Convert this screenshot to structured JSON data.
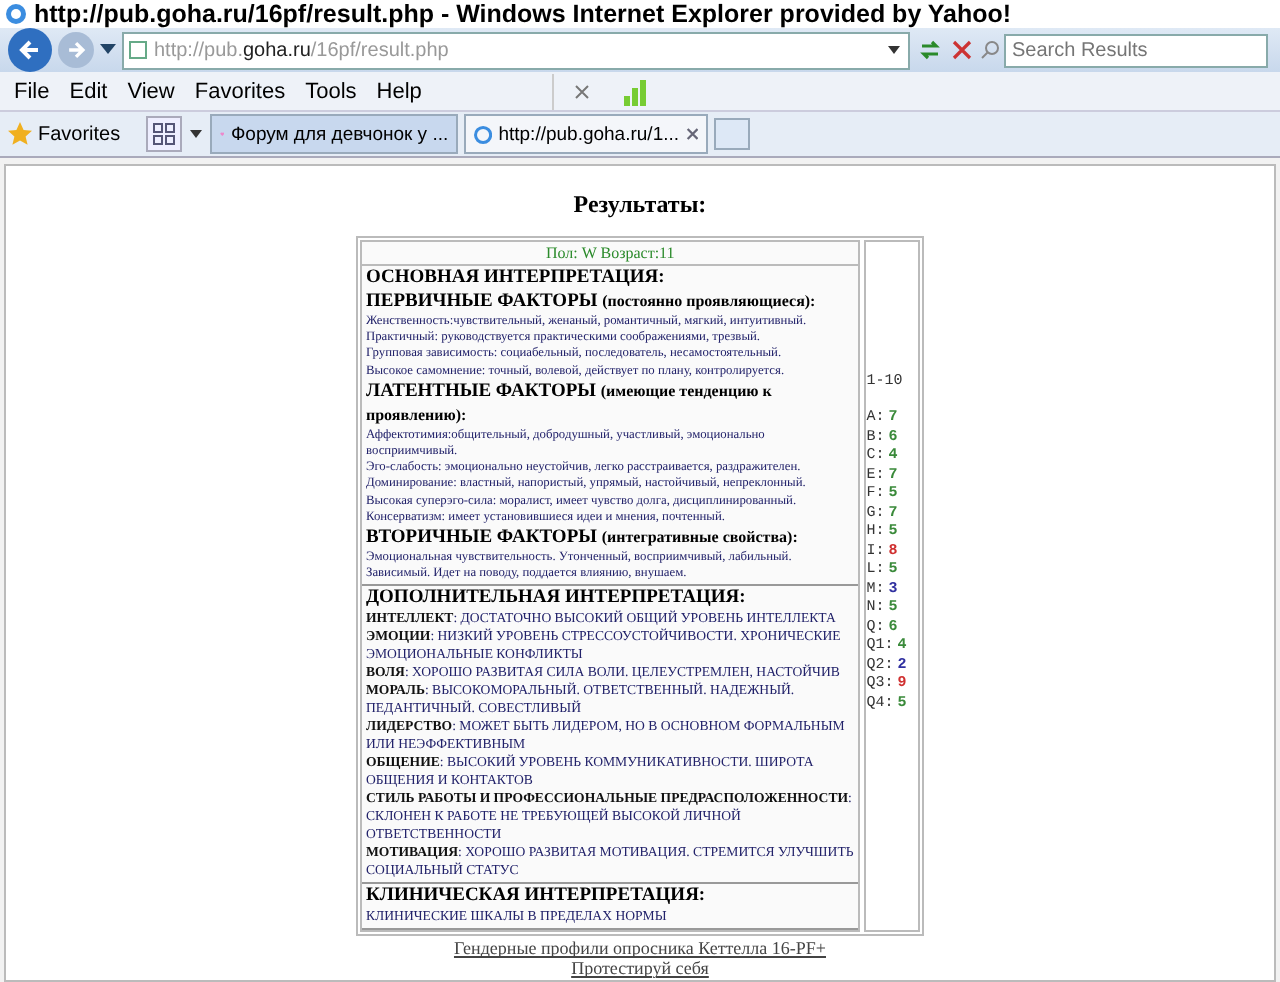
{
  "window": {
    "title": "http://pub.goha.ru/16pf/result.php - Windows Internet Explorer provided by Yahoo!"
  },
  "address_bar": {
    "url_prefix": "http://pub.",
    "url_host": "goha.ru",
    "url_path": "/16pf/result.php",
    "search_placeholder": "Search Results"
  },
  "menu": [
    "File",
    "Edit",
    "View",
    "Favorites",
    "Tools",
    "Help"
  ],
  "favorites_bar": {
    "label": "Favorites",
    "tabs": [
      {
        "title": "Форум для девчонок у ...",
        "selected": false
      },
      {
        "title": "http://pub.goha.ru/1...",
        "selected": true
      }
    ]
  },
  "page": {
    "heading": "Результаты:",
    "info": "Пол: W   Возраст:11",
    "sections": [
      {
        "kind": "main",
        "title": "ОСНОВНАЯ ИНТЕРПРЕТАЦИЯ:",
        "groups": [
          {
            "title": "ПЕРВИЧНЫЕ ФАКТОРЫ",
            "note": "(постоянно проявляющиеся):",
            "lines": [
              "Женственность:чувствительный, женаный, романтичный, мягкий, интуитивный.",
              "Практичный: руководствуется практическими соображениями, трезвый.",
              "Групповая зависимость: социабельный, последователь, несамостоятельный.",
              "Высокое самомнение: точный, волевой, действует по плану, контролируется."
            ]
          },
          {
            "title": "ЛАТЕНТНЫЕ ФАКТОРЫ",
            "note": "(имеющие тенденцию к проявлению):",
            "lines": [
              "Аффектотимия:общительный, добродушный, участливый, эмоционально восприимчивый.",
              "Эго-слабость: эмоционально неустойчив, легко расстраивается, раздражителен.",
              "Доминирование: властный, напористый, упрямый, настойчивый, непреклонный.",
              "Высокая суперэго-сила: моралист, имеет чувство долга, дисциплинированный.",
              "Консерватизм: имеет установившиеся идеи и мнения, почтенный."
            ]
          },
          {
            "title": "ВТОРИЧНЫЕ ФАКТОРЫ",
            "note": "(интегративные свойства):",
            "lines": [
              "Эмоциональная чувствительность. Утонченный, восприимчивый, лабильный.",
              "Зависимый. Идет на поводу, поддается влиянию, внушаем."
            ]
          }
        ]
      },
      {
        "kind": "extra",
        "title": "ДОПОЛНИТЕЛЬНАЯ ИНТЕРПРЕТАЦИЯ:",
        "items": [
          "**ИНТЕЛЛЕКТ**: ДОСТАТОЧНО ВЫСОКИЙ ОБЩИЙ УРОВЕНЬ ИНТЕЛЛЕКТА",
          "**ЭМОЦИИ**: НИЗКИЙ УРОВЕНЬ СТРЕССОУСТОЙЧИВОСТИ. ХРОНИЧЕСКИЕ ЭМОЦИОНАЛЬНЫЕ КОНФЛИКТЫ",
          "**ВОЛЯ**: ХОРОШО РАЗВИТАЯ СИЛА ВОЛИ. ЦЕЛЕУСТРЕМЛЕН, НАСТОЙЧИВ",
          "**МОРАЛЬ**: ВЫСОКОМОРАЛЬНЫЙ. ОТВЕТСТВЕННЫЙ. НАДЕЖНЫЙ. ПЕДАНТИЧНЫЙ. СОВЕСТЛИВЫЙ",
          "**ЛИДЕРСТВО**: МОЖЕТ БЫТЬ ЛИДЕРОМ, НО В ОСНОВНОМ ФОРМАЛЬНЫМ ИЛИ НЕЭФФЕКТИВНЫМ",
          "**ОБЩЕНИЕ**: ВЫСОКИЙ УРОВЕНЬ КОММУНИКАТИВНОСТИ. ШИРОТА ОБЩЕНИЯ И КОНТАКТОВ",
          "**СТИЛЬ РАБОТЫ И ПРОФЕССИОНАЛЬНЫЕ ПРЕДРАСПОЛОЖЕННОСТИ**: СКЛОНЕН К РАБОТЕ НЕ ТРЕБУЮЩЕЙ ВЫСОКОЙ ЛИЧНОЙ ОТВЕТСТВЕННОСТИ",
          "**МОТИВАЦИЯ**: ХОРОШО РАЗВИТАЯ МОТИВАЦИЯ. СТРЕМИТСЯ УЛУЧШИТЬ СОЦИАЛЬНЫЙ СТАТУС"
        ]
      },
      {
        "kind": "extra",
        "title": "КЛИНИЧЕСКАЯ ИНТЕРПРЕТАЦИЯ:",
        "items": [
          "КЛИНИЧЕСКИЕ ШКАЛЫ В ПРЕДЕЛАХ НОРМЫ"
        ]
      }
    ],
    "scale_label": "1-10",
    "scores": [
      {
        "factor": "A:",
        "value": "7",
        "color": "#3a8a3a"
      },
      {
        "factor": "B:",
        "value": "6",
        "color": "#3a8a3a"
      },
      {
        "factor": "C:",
        "value": "4",
        "color": "#3a8a3a"
      },
      {
        "factor": "E:",
        "value": "7",
        "color": "#3a8a3a"
      },
      {
        "factor": "F:",
        "value": "5",
        "color": "#3a8a3a"
      },
      {
        "factor": "G:",
        "value": "7",
        "color": "#3a8a3a"
      },
      {
        "factor": "H:",
        "value": "5",
        "color": "#3a8a3a"
      },
      {
        "factor": "I:",
        "value": "8",
        "color": "#d03030"
      },
      {
        "factor": "L:",
        "value": "5",
        "color": "#3a8a3a"
      },
      {
        "factor": "M:",
        "value": "3",
        "color": "#3030a0"
      },
      {
        "factor": "N:",
        "value": "5",
        "color": "#3a8a3a"
      },
      {
        "factor": "Q:",
        "value": "6",
        "color": "#3a8a3a"
      },
      {
        "factor": "Q1:",
        "value": "4",
        "color": "#3a8a3a"
      },
      {
        "factor": "Q2:",
        "value": "2",
        "color": "#3030a0"
      },
      {
        "factor": "Q3:",
        "value": "9",
        "color": "#d03030"
      },
      {
        "factor": "Q4:",
        "value": "5",
        "color": "#3a8a3a"
      }
    ],
    "links": [
      "Гендерные профили опросника Кеттелла 16-PF+",
      "Протестируй себя"
    ]
  }
}
